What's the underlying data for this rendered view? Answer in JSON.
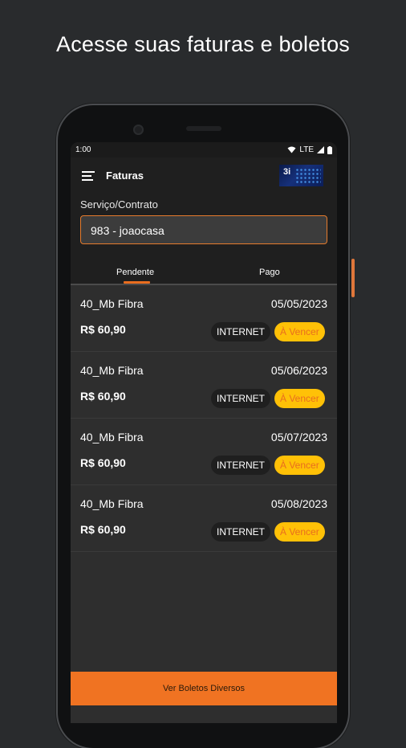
{
  "headline": "Acesse suas faturas e boletos",
  "status": {
    "time": "1:00",
    "network": "LTE"
  },
  "appbar": {
    "title": "Faturas",
    "logo_text": "3i"
  },
  "form": {
    "label": "Serviço/Contrato",
    "selected": "983 - joaocasa"
  },
  "tabs": [
    {
      "label": "Pendente",
      "active": true
    },
    {
      "label": "Pago",
      "active": false
    }
  ],
  "invoices": [
    {
      "name": "40_Mb Fibra",
      "date": "05/05/2023",
      "price": "R$ 60,90",
      "tag": "INTERNET",
      "status": "À Vencer"
    },
    {
      "name": "40_Mb Fibra",
      "date": "05/06/2023",
      "price": "R$ 60,90",
      "tag": "INTERNET",
      "status": "À Vencer"
    },
    {
      "name": "40_Mb Fibra",
      "date": "05/07/2023",
      "price": "R$ 60,90",
      "tag": "INTERNET",
      "status": "À Vencer"
    },
    {
      "name": "40_Mb Fibra",
      "date": "05/08/2023",
      "price": "R$ 60,90",
      "tag": "INTERNET",
      "status": "À Vencer"
    }
  ],
  "bottom_button": "Ver Boletos Diversos",
  "colors": {
    "accent": "#f07322",
    "status_badge": "#ffc107",
    "background": "#292b2d"
  },
  "icons": [
    "menu-icon",
    "wifi-icon",
    "signal-icon",
    "battery-icon"
  ]
}
